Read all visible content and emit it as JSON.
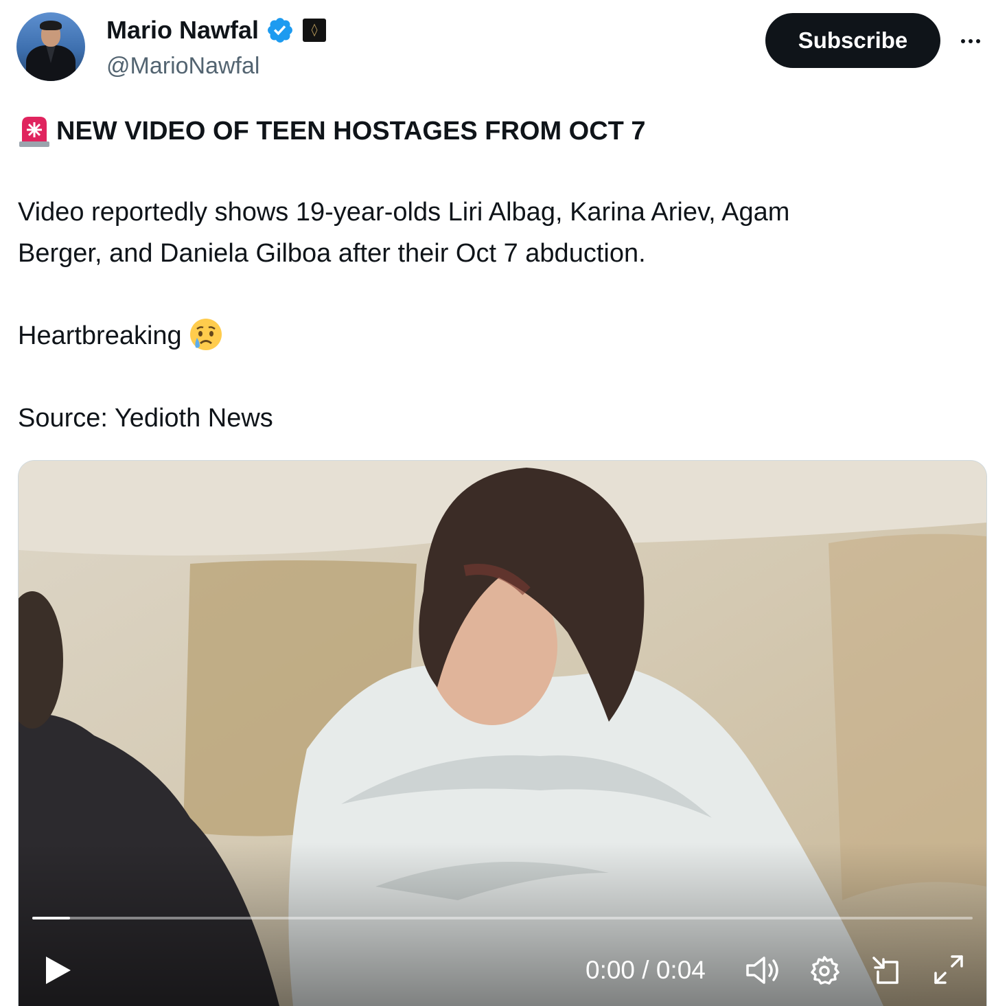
{
  "author": {
    "display_name": "Mario Nawfal",
    "handle": "@MarioNawfal",
    "verified_icon": "verified-check-icon",
    "affiliate_badge_icon": "affiliate-badge-icon"
  },
  "actions": {
    "subscribe_label": "Subscribe",
    "more_icon": "more-options-icon"
  },
  "post": {
    "headline_icon": "police-siren-emoji",
    "headline": "NEW VIDEO OF TEEN HOSTAGES FROM OCT 7",
    "paragraph_line1": "Video reportedly shows 19-year-olds Liri Albag, Karina Ariev, Agam",
    "paragraph_line2": "Berger, and Daniela Gilboa after their Oct 7 abduction.",
    "reaction": "Heartbreaking",
    "reaction_emoji": "crying-face-emoji",
    "source": "Source: Yedioth News"
  },
  "video": {
    "time_display": "0:00 / 0:04",
    "progress_fraction": 0.04,
    "controls": [
      "play-icon",
      "volume-icon",
      "settings-gear-icon",
      "picture-in-picture-icon",
      "fullscreen-icon"
    ]
  },
  "colors": {
    "text_primary": "#0f1419",
    "text_secondary": "#536471",
    "verified_blue": "#1d9bf0",
    "button_dark": "#0f1419"
  }
}
